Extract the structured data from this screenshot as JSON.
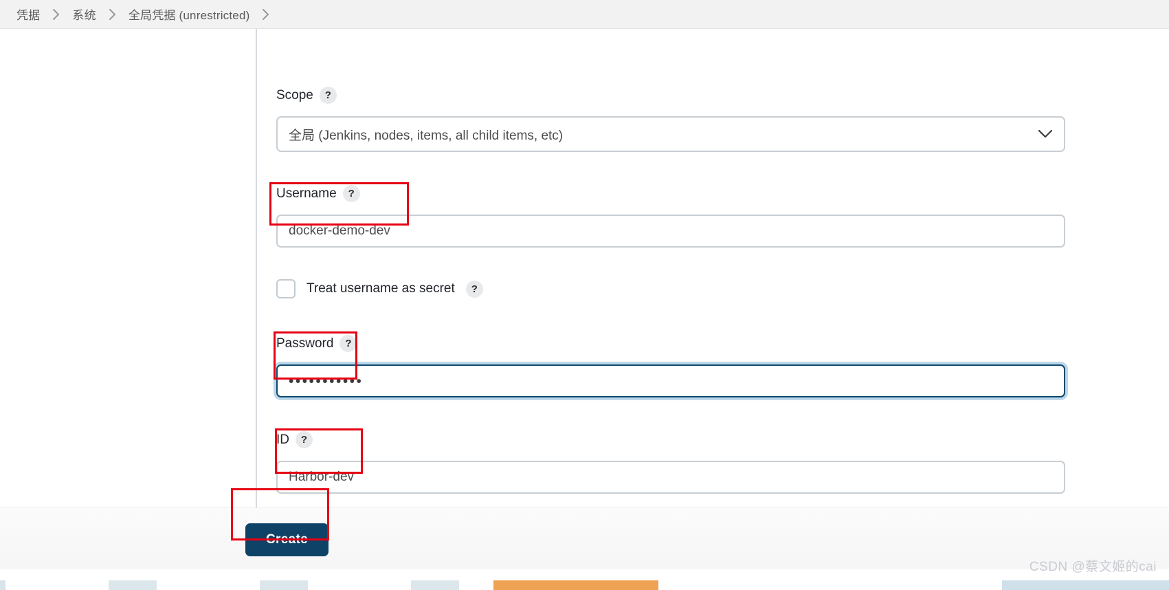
{
  "breadcrumb": {
    "items": [
      {
        "label": "凭据"
      },
      {
        "label": "系统"
      },
      {
        "label": "全局凭据 (unrestricted)"
      }
    ],
    "separator": "›"
  },
  "form": {
    "scope": {
      "label": "Scope",
      "help": "?",
      "value": "全局 (Jenkins, nodes, items, all child items, etc)",
      "caret": "chevron-down"
    },
    "username": {
      "label": "Username",
      "help": "?",
      "value": "docker-demo-dev",
      "placeholder": ""
    },
    "treat_secret": {
      "label": "Treat username as secret",
      "help": "?",
      "checked": false
    },
    "password": {
      "label": "Password",
      "help": "?",
      "value": "•••••••••••",
      "focused": true
    },
    "id": {
      "label": "ID",
      "help": "?",
      "value": "Harbor-dev",
      "placeholder": ""
    }
  },
  "actions": {
    "create_label": "Create"
  },
  "watermark": {
    "text": "CSDN @蔡文姬的cai"
  },
  "colors": {
    "accent": "#0e4266",
    "annotation": "#e60012",
    "focus_ring": "#bcd7ea",
    "border": "#c8ced3",
    "breadcrumb_bg": "#f2f2f3"
  }
}
